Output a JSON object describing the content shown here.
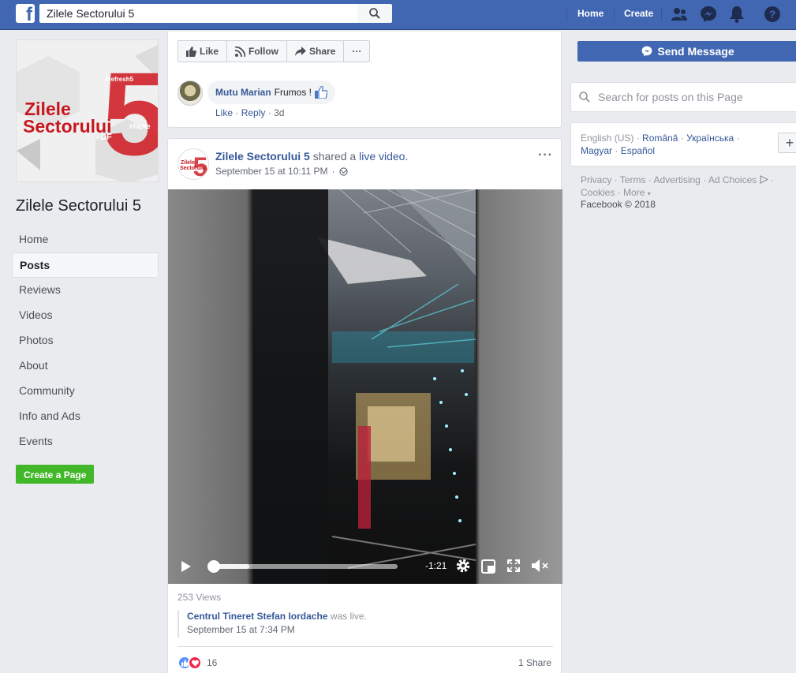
{
  "topbar": {
    "search_value": "Zilele Sectorului 5",
    "home_label": "Home",
    "create_label": "Create"
  },
  "page": {
    "logo_line1": "Zilele",
    "logo_line2": "Sectorului",
    "logo_tag1": "#refresh5",
    "logo_tag2": "#DF",
    "logo_tag3": "#fapte",
    "name": "Zilele Sectorului 5",
    "nav": [
      "Home",
      "Posts",
      "Reviews",
      "Videos",
      "Photos",
      "About",
      "Community",
      "Info and Ads",
      "Events"
    ],
    "active_nav": "Posts",
    "create_page_label": "Create a Page"
  },
  "actions": {
    "like": "Like",
    "follow": "Follow",
    "share": "Share",
    "more": "···"
  },
  "comment": {
    "author": "Mutu Marian",
    "text": "Frumos !",
    "like": "Like",
    "reply": "Reply",
    "age": "3d"
  },
  "post": {
    "author": "Zilele Sectorului 5",
    "shared_text": "shared a",
    "shared_link": "live video.",
    "time": "September 15 at 10:11 PM",
    "more": "···",
    "video_time": "-1:21",
    "video_progress": 0.0,
    "video_buffered": 0.2,
    "views": "253 Views",
    "origin_name": "Centrul Tineret Stefan Iordache",
    "origin_text": "was live.",
    "origin_time": "September 15 at 7:34 PM",
    "reaction_count": "16",
    "shares": "1 Share"
  },
  "right": {
    "send_message": "Send Message",
    "search_placeholder": "Search for posts on this Page",
    "lang_current": "English (US)",
    "lang_1": "Română",
    "lang_2": "Українська",
    "lang_3": "Magyar",
    "lang_4": "Español",
    "lang_add": "+",
    "footer_privacy": "Privacy",
    "footer_terms": "Terms",
    "footer_advertising": "Advertising",
    "footer_adchoices": "Ad Choices",
    "footer_cookies": "Cookies",
    "footer_more": "More",
    "copyright": "Facebook © 2018"
  },
  "colors": {
    "brand": "#4267b2",
    "link": "#365899",
    "green": "#42b72a",
    "logo_red": "#d0232a"
  }
}
